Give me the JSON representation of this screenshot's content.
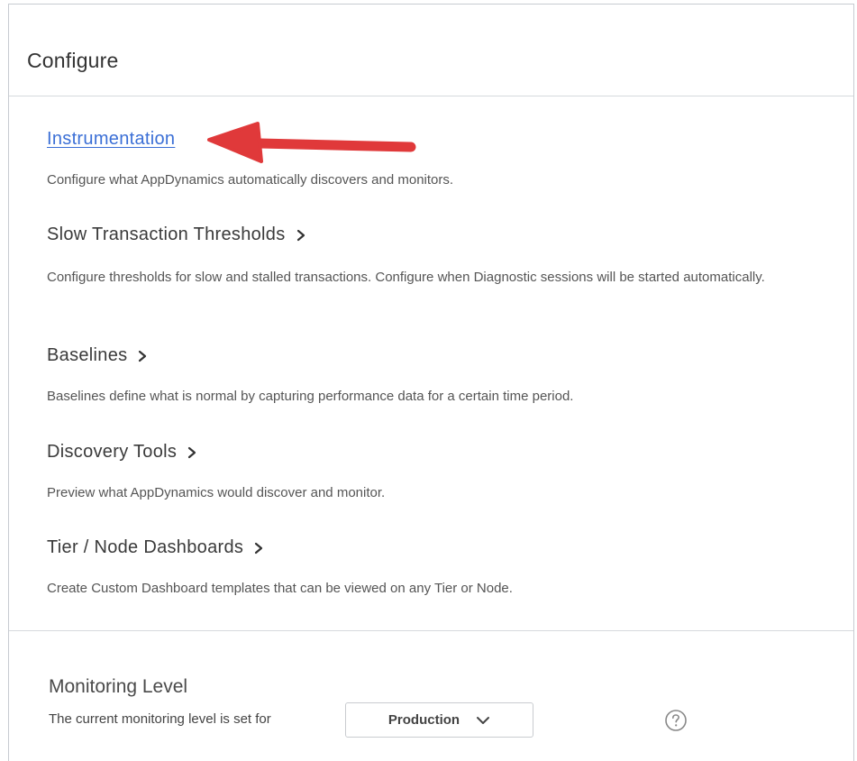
{
  "panel": {
    "title": "Configure"
  },
  "sections": [
    {
      "label": "Instrumentation",
      "description": "Configure what AppDynamics automatically discovers and monitors."
    },
    {
      "label": "Slow Transaction Thresholds",
      "description": "Configure thresholds for slow and stalled transactions. Configure when Diagnostic sessions will be started automatically."
    },
    {
      "label": "Baselines",
      "description": "Baselines define what is normal by capturing performance data for a certain time period."
    },
    {
      "label": "Discovery Tools",
      "description": "Preview what AppDynamics would discover and monitor."
    },
    {
      "label": "Tier / Node Dashboards",
      "description": "Create Custom Dashboard templates that can be viewed on any Tier or Node."
    }
  ],
  "monitoring": {
    "title": "Monitoring Level",
    "description": "The current monitoring level is set for",
    "selected": "Production"
  },
  "icons": {
    "chevron": "chevron-right-icon",
    "dropdown": "chevron-down-icon",
    "help": "help-icon",
    "annotation": "red-arrow-icon"
  },
  "colors": {
    "link": "#3b6fd6",
    "annotation_arrow": "#e0393a",
    "border": "#d6d9dd"
  }
}
